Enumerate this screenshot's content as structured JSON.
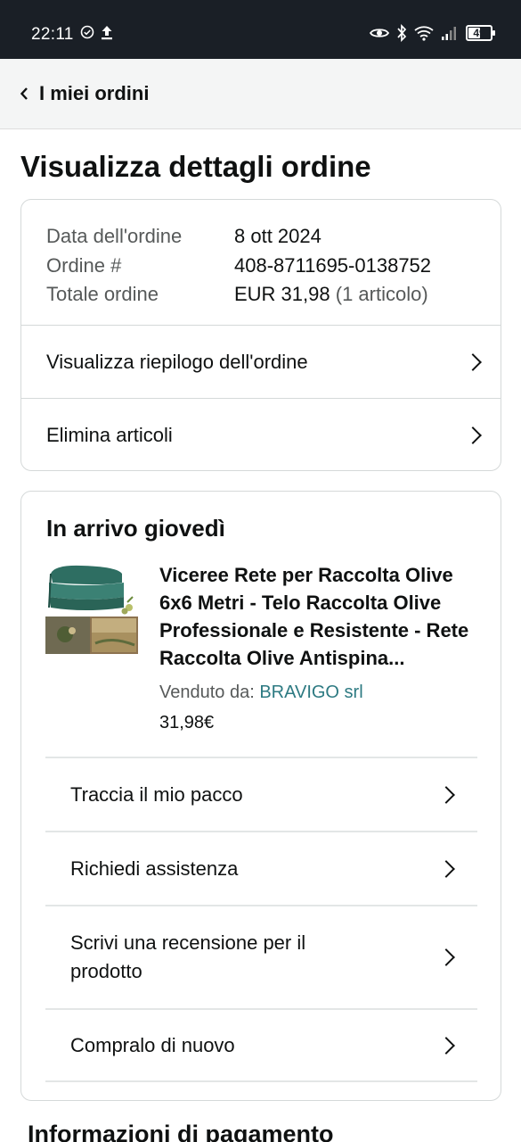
{
  "status_bar": {
    "time": "22:11",
    "battery": "49"
  },
  "header": {
    "back_label": "I miei ordini"
  },
  "page_title": "Visualizza dettagli ordine",
  "order_summary": {
    "date_label": "Data dell'ordine",
    "date_value": "8 ott 2024",
    "number_label": "Ordine #",
    "number_value": "408-8711695-0138752",
    "total_label": "Totale ordine",
    "total_value": "EUR 31,98",
    "total_items": "(1 articolo)",
    "links": [
      "Visualizza riepilogo dell'ordine",
      "Elimina articoli"
    ]
  },
  "shipment": {
    "title": "In arrivo giovedì",
    "product_title": "Viceree Rete per Raccolta Olive 6x6 Metri - Telo Raccolta Olive Professionale e Resistente - Rete Raccolta Olive Antispina...",
    "sold_by_label": "Venduto da:",
    "seller": "BRAVIGO srl",
    "price": "31,98€",
    "actions": [
      "Traccia il mio pacco",
      "Richiedi assistenza",
      "Scrivi una recensione per il prodotto",
      "Compralo di nuovo"
    ]
  },
  "payment_heading": "Informazioni di pagamento",
  "colors": {
    "link": "#2d7a82",
    "status_bar": "#1a1f26"
  }
}
